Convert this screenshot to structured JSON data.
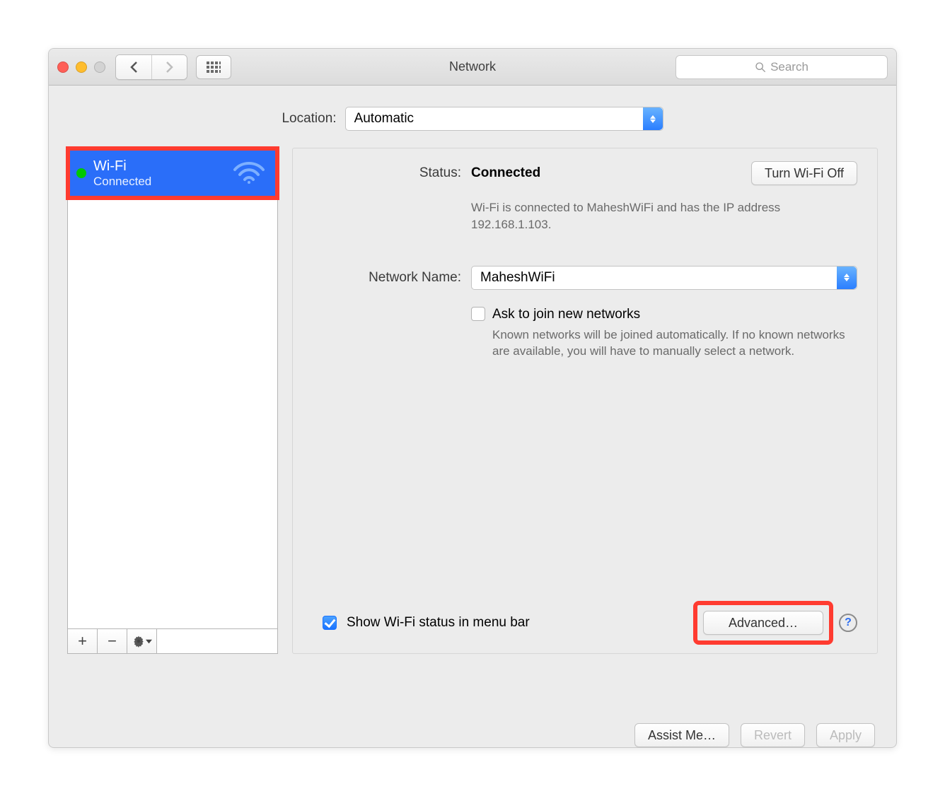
{
  "window": {
    "title": "Network"
  },
  "search": {
    "placeholder": "Search"
  },
  "location": {
    "label": "Location:",
    "value": "Automatic"
  },
  "sidebar": {
    "items": [
      {
        "name": "Wi-Fi",
        "status": "Connected"
      }
    ],
    "buttons": {
      "add": "+",
      "remove": "−"
    }
  },
  "status": {
    "label": "Status:",
    "value": "Connected",
    "toggle": "Turn Wi-Fi Off",
    "detail": "Wi-Fi is connected to MaheshWiFi and has the IP address 192.168.1.103."
  },
  "network_name": {
    "label": "Network Name:",
    "value": "MaheshWiFi"
  },
  "ask_join": {
    "label": "Ask to join new networks",
    "detail": "Known networks will be joined automatically. If no known networks are available, you will have to manually select a network."
  },
  "show_menu": {
    "label": "Show Wi-Fi status in menu bar"
  },
  "advanced": {
    "label": "Advanced…"
  },
  "footer": {
    "assist": "Assist Me…",
    "revert": "Revert",
    "apply": "Apply"
  },
  "help": "?"
}
